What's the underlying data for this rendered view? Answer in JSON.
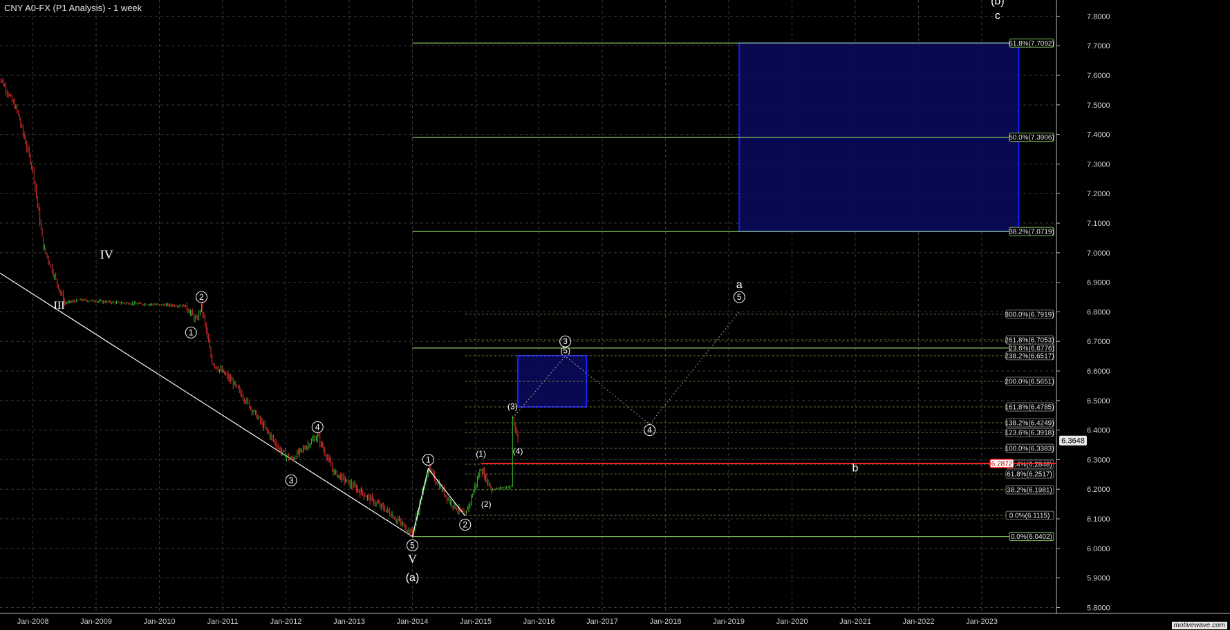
{
  "page": {
    "title": "CNY A0-FX (P1 Analysis) - 1 week",
    "watermark": "motivewave.com"
  },
  "colors": {
    "background": "#000000",
    "grid": "#3a3a3a",
    "up_bar": "#2fbf2f",
    "down_bar": "#e03030",
    "fib_level": "#7fbf5a",
    "projection": "#1a1aff",
    "projection_fill": "#0a0a55",
    "trendline": "#ffffff",
    "current_level": "#ff2020"
  },
  "chart_data": {
    "type": "candlestick",
    "title": "CNY A0-FX (P1 Analysis) - 1 week",
    "x_range": [
      "2007-06",
      "2023-08"
    ],
    "ylim": [
      5.78,
      7.84
    ],
    "y_axis": "right",
    "grid": true,
    "x_ticks": [
      "Jan-2008",
      "Jan-2009",
      "Jan-2010",
      "Jan-2011",
      "Jan-2012",
      "Jan-2013",
      "Jan-2014",
      "Jan-2015",
      "Jan-2016",
      "Jan-2017",
      "Jan-2018",
      "Jan-2019",
      "Jan-2020",
      "Jan-2021",
      "Jan-2022",
      "Jan-2023"
    ],
    "y_ticks": [
      "5.8000",
      "5.9000",
      "6.0000",
      "6.1000",
      "6.2000",
      "6.3000",
      "6.4000",
      "6.5000",
      "6.6000",
      "6.7000",
      "6.8000",
      "6.9000",
      "7.0000",
      "7.1000",
      "7.2000",
      "7.3000",
      "7.4000",
      "7.5000",
      "7.6000",
      "7.7000",
      "7.8000"
    ],
    "last_price": "6.3648",
    "current_level": {
      "label": "6.2872",
      "value": 6.2872
    },
    "price_path": [
      {
        "date": "2007-06",
        "price": 7.62
      },
      {
        "date": "2007-10",
        "price": 7.48
      },
      {
        "date": "2008-01",
        "price": 7.28
      },
      {
        "date": "2008-03",
        "price": 7.02
      },
      {
        "date": "2008-07",
        "price": 6.83
      },
      {
        "date": "2008-10",
        "price": 6.84
      },
      {
        "date": "2009-06",
        "price": 6.83
      },
      {
        "date": "2010-06",
        "price": 6.82
      },
      {
        "date": "2010-08",
        "price": 6.77
      },
      {
        "date": "2010-09",
        "price": 6.82
      },
      {
        "date": "2010-11",
        "price": 6.63
      },
      {
        "date": "2011-03",
        "price": 6.56
      },
      {
        "date": "2011-07",
        "price": 6.46
      },
      {
        "date": "2011-12",
        "price": 6.33
      },
      {
        "date": "2012-02",
        "price": 6.3
      },
      {
        "date": "2012-07",
        "price": 6.38
      },
      {
        "date": "2012-10",
        "price": 6.26
      },
      {
        "date": "2013-04",
        "price": 6.18
      },
      {
        "date": "2013-08",
        "price": 6.13
      },
      {
        "date": "2014-01",
        "price": 6.05
      },
      {
        "date": "2014-04",
        "price": 6.27
      },
      {
        "date": "2014-08",
        "price": 6.16
      },
      {
        "date": "2014-11",
        "price": 6.11
      },
      {
        "date": "2015-02",
        "price": 6.27
      },
      {
        "date": "2015-04",
        "price": 6.2
      },
      {
        "date": "2015-08",
        "price": 6.21
      },
      {
        "date": "2015-08",
        "price": 6.44
      },
      {
        "date": "2015-09",
        "price": 6.36
      }
    ],
    "trendline": {
      "from": {
        "date": "2007-06",
        "price": 6.94
      },
      "to": {
        "date": "2014-01",
        "price": 6.04
      }
    },
    "wave_lines": [
      {
        "points": [
          {
            "date": "2014-01",
            "price": 6.04
          },
          {
            "date": "2014-04",
            "price": 6.27
          },
          {
            "date": "2014-11",
            "price": 6.11
          }
        ],
        "style": "solid"
      },
      {
        "points": [
          {
            "date": "2015-08",
            "price": 6.44
          },
          {
            "date": "2016-06",
            "price": 6.65
          },
          {
            "date": "2017-10",
            "price": 6.42
          },
          {
            "date": "2019-03",
            "price": 6.8
          }
        ],
        "style": "dotted"
      }
    ],
    "fib_levels_long": [
      {
        "label": "61.8%(7.7092)",
        "value": 7.7092
      },
      {
        "label": "50.0%(7.3906)",
        "value": 7.3906
      },
      {
        "label": "38.2%(7.0719)",
        "value": 7.0719
      },
      {
        "label": "23.6%(6.6776)",
        "value": 6.6776
      },
      {
        "label": "0.0%(6.0402)",
        "value": 6.0402
      }
    ],
    "fib_levels_short": [
      {
        "label": "300.0%(6.7919)",
        "value": 6.7919
      },
      {
        "label": "261.8%(6.7053)",
        "value": 6.7053
      },
      {
        "label": "238.2%(6.6517)",
        "value": 6.6517
      },
      {
        "label": "200.0%(6.5651)",
        "value": 6.5651
      },
      {
        "label": "161.8%(6.4785)",
        "value": 6.4785
      },
      {
        "label": "138.2%(6.4249)",
        "value": 6.4249
      },
      {
        "label": "123.6%(6.3918)",
        "value": 6.3918
      },
      {
        "label": "100.0%(6.3383)",
        "value": 6.3383
      },
      {
        "label": "76.4%(6.2848)",
        "value": 6.2848
      },
      {
        "label": "61.8%(6.2517)",
        "value": 6.2517
      },
      {
        "label": "38.2%(6.1981)",
        "value": 6.1981
      },
      {
        "label": "0.0%(6.1115)",
        "value": 6.1115
      }
    ],
    "projection_boxes": [
      {
        "from_date": "2019-03",
        "to_date": "2023-08",
        "high": 7.7092,
        "low": 7.0719
      },
      {
        "from_date": "2015-09",
        "to_date": "2016-10",
        "high": 6.6517,
        "low": 6.4785
      }
    ],
    "wave_labels": [
      {
        "text": "IV",
        "date": "2009-03",
        "price": 6.98,
        "kind": "roman",
        "size": 18
      },
      {
        "text": "III",
        "date": "2008-06",
        "price": 6.81,
        "kind": "roman",
        "size": 16
      },
      {
        "text": "V",
        "date": "2014-01",
        "price": 5.95,
        "kind": "roman",
        "size": 18
      },
      {
        "text": "(a)",
        "date": "2014-01",
        "price": 5.89,
        "kind": "plain",
        "size": 16
      },
      {
        "text": "(b)",
        "date": "2023-04",
        "price": 7.84,
        "kind": "plain",
        "size": 16
      },
      {
        "text": "c",
        "date": "2023-04",
        "price": 7.79,
        "kind": "plain",
        "size": 16
      },
      {
        "text": "a",
        "date": "2019-03",
        "price": 6.88,
        "kind": "plain",
        "size": 16
      },
      {
        "text": "b",
        "date": "2021-01",
        "price": 6.26,
        "kind": "plain",
        "size": 16
      },
      {
        "text": "(1)",
        "date": "2015-02",
        "price": 6.31,
        "kind": "plain",
        "size": 12
      },
      {
        "text": "(2)",
        "date": "2015-03",
        "price": 6.14,
        "kind": "plain",
        "size": 12
      },
      {
        "text": "(3)",
        "date": "2015-08",
        "price": 6.47,
        "kind": "plain",
        "size": 12
      },
      {
        "text": "(4)",
        "date": "2015-09",
        "price": 6.32,
        "kind": "plain",
        "size": 12
      },
      {
        "text": "(5)",
        "date": "2016-06",
        "price": 6.66,
        "kind": "plain",
        "size": 12
      },
      {
        "text": "1",
        "date": "2010-07",
        "price": 6.73,
        "kind": "circle",
        "size": 12
      },
      {
        "text": "2",
        "date": "2010-09",
        "price": 6.85,
        "kind": "circle",
        "size": 12
      },
      {
        "text": "3",
        "date": "2012-02",
        "price": 6.23,
        "kind": "circle",
        "size": 12
      },
      {
        "text": "4",
        "date": "2012-07",
        "price": 6.41,
        "kind": "circle",
        "size": 12
      },
      {
        "text": "5",
        "date": "2014-01",
        "price": 6.01,
        "kind": "circle",
        "size": 12
      },
      {
        "text": "1",
        "date": "2014-04",
        "price": 6.3,
        "kind": "circle",
        "size": 12
      },
      {
        "text": "2",
        "date": "2014-11",
        "price": 6.08,
        "kind": "circle",
        "size": 12
      },
      {
        "text": "3",
        "date": "2016-06",
        "price": 6.7,
        "kind": "circle",
        "size": 12
      },
      {
        "text": "4",
        "date": "2017-10",
        "price": 6.4,
        "kind": "circle",
        "size": 12
      },
      {
        "text": "5",
        "date": "2019-03",
        "price": 6.85,
        "kind": "circle",
        "size": 12
      }
    ]
  }
}
